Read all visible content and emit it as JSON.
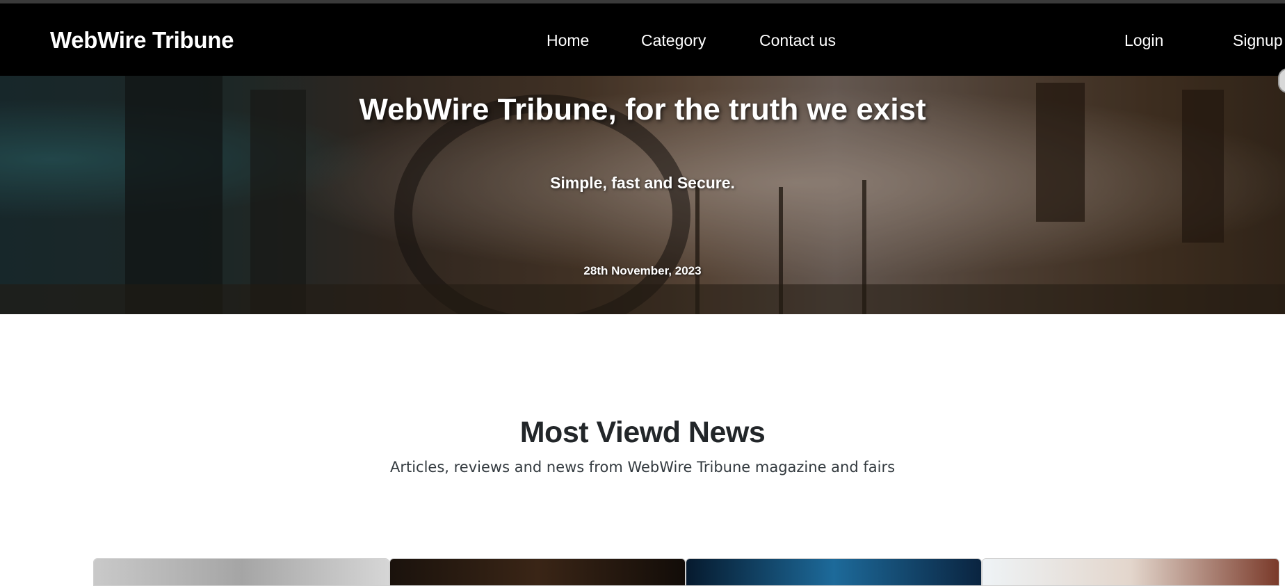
{
  "header": {
    "brand": "WebWire Tribune",
    "nav": [
      {
        "label": "Home"
      },
      {
        "label": "Category"
      },
      {
        "label": "Contact us"
      }
    ],
    "auth": {
      "login": "Login",
      "signup": "Signup"
    }
  },
  "hero": {
    "title": "WebWire Tribune, for the truth we exist",
    "subtitle": "Simple, fast and Secure.",
    "date": "28th November, 2023"
  },
  "most_viewed": {
    "title": "Most Viewd News",
    "subtitle": "Articles, reviews and news from WebWire Tribune magazine and fairs"
  },
  "cards": [
    {
      "thumb_color": "#b7b7b7"
    },
    {
      "thumb_color": "#2a1e16"
    },
    {
      "thumb_color": "#0d2d4a"
    },
    {
      "thumb_color": "#e6e0da"
    }
  ],
  "colors": {
    "navbar_bg": "#000000",
    "text_dark": "#222629",
    "link": "#ffffff"
  }
}
